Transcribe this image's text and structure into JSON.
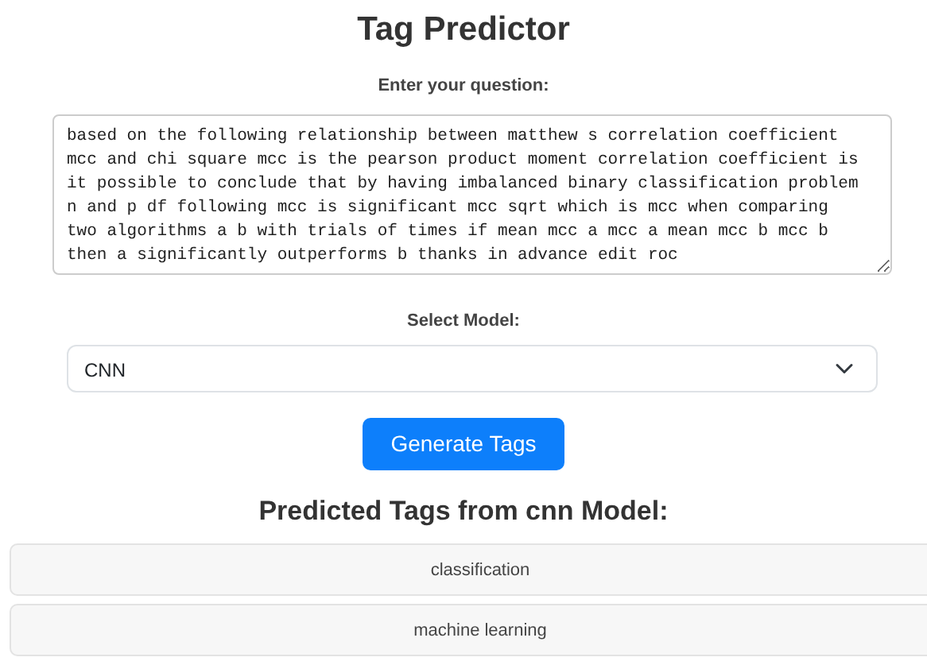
{
  "title": "Tag Predictor",
  "question": {
    "label": "Enter your question:",
    "value": "based on the following relationship between matthew s correlation coefficient mcc and chi square mcc is the pearson product moment correlation coefficient is it possible to conclude that by having imbalanced binary classification problem n and p df following mcc is significant mcc sqrt which is mcc when comparing two algorithms a b with trials of times if mean mcc a mcc a mean mcc b mcc b then a significantly outperforms b thanks in advance edit roc"
  },
  "model": {
    "label": "Select Model:",
    "value": "CNN"
  },
  "generate_button": "Generate Tags",
  "results": {
    "heading": "Predicted Tags from cnn Model:",
    "tags": [
      "classification",
      "machine learning"
    ]
  }
}
